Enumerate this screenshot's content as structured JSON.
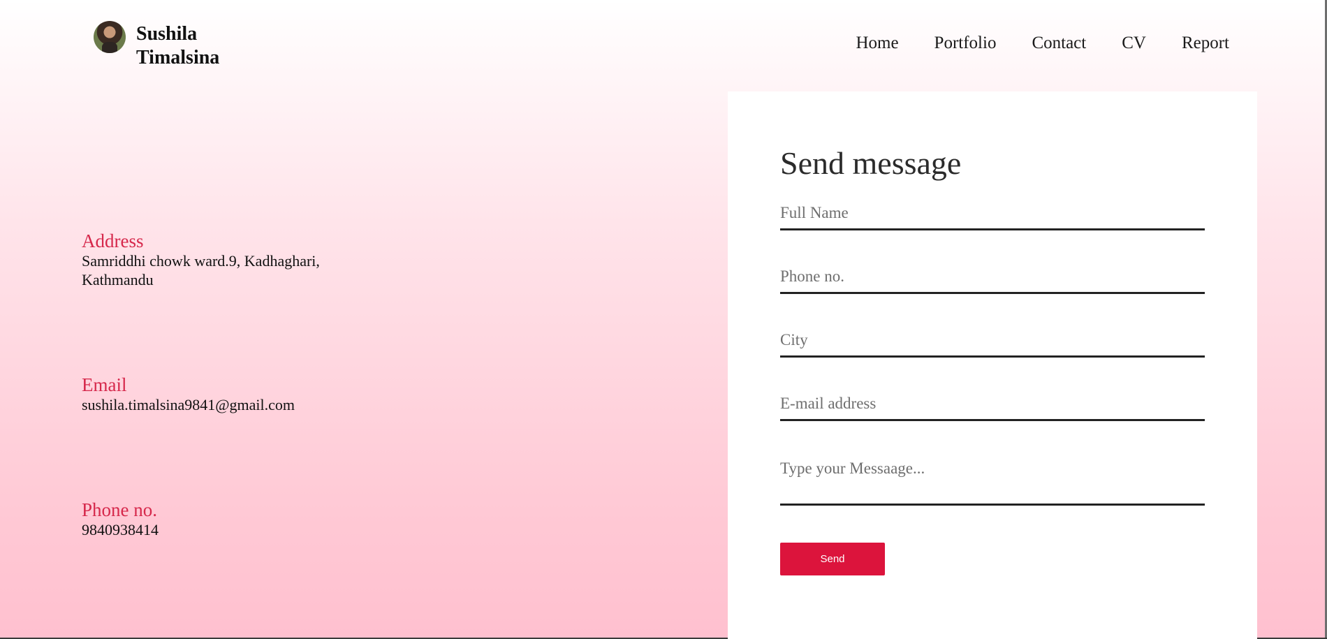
{
  "brand": {
    "name": "Sushila Timalsina"
  },
  "nav": {
    "items": [
      {
        "label": "Home"
      },
      {
        "label": "Portfolio"
      },
      {
        "label": "Contact"
      },
      {
        "label": "CV"
      },
      {
        "label": "Report"
      }
    ]
  },
  "contact": {
    "address": {
      "label": "Address",
      "value": "Samriddhi chowk ward.9, Kadhaghari, Kathmandu"
    },
    "email": {
      "label": "Email",
      "value": "sushila.timalsina9841@gmail.com"
    },
    "phone": {
      "label": "Phone no.",
      "value": "9840938414"
    }
  },
  "form": {
    "title": "Send message",
    "full_name_placeholder": "Full Name",
    "phone_placeholder": "Phone no.",
    "city_placeholder": "City",
    "email_placeholder": "E-mail address",
    "message_placeholder": "Type your Messaage...",
    "send_label": "Send"
  },
  "colors": {
    "accent": "#dc143c",
    "label": "#d6284b"
  }
}
